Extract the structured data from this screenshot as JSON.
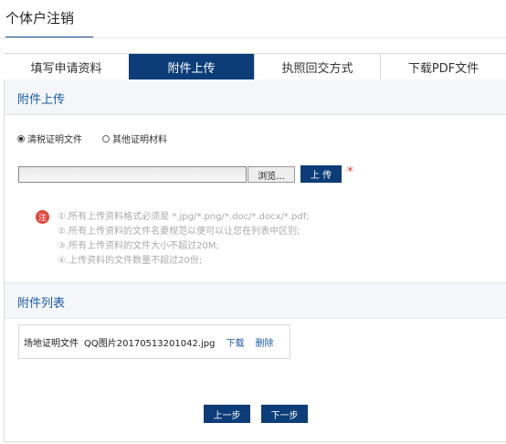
{
  "page": {
    "title": "个体户注销"
  },
  "tabs": [
    {
      "label": "填写申请资料"
    },
    {
      "label": "附件上传"
    },
    {
      "label": "执照回交方式"
    },
    {
      "label": "下载PDF文件"
    }
  ],
  "upload_section": {
    "title": "附件上传",
    "radio_options": [
      {
        "label": "清税证明文件",
        "selected": true
      },
      {
        "label": "其他证明材料",
        "selected": false
      }
    ],
    "browse_label": "浏览...",
    "upload_label": "上 传",
    "required_mark": "*",
    "note_icon_label": "注",
    "notes": [
      "①.所有上传资料格式必须是 *.jpg/*.png/*.doc/*.docx/*.pdf;",
      "②.所有上传资料的文件名要规范以便可以让您在列表中区别;",
      "③.所有上传资料的文件大小不超过20M;",
      "④.上传资料的文件数量不超过20份;"
    ]
  },
  "list_section": {
    "title": "附件列表",
    "files": [
      {
        "type": "场地证明文件",
        "name": "QQ图片20170513201042.jpg",
        "download": "下载",
        "delete": "删除"
      }
    ]
  },
  "buttons": {
    "prev": "上一步",
    "next": "下一步"
  },
  "colors": {
    "primary": "#0d3d78",
    "link": "#1a5aa5",
    "required": "#e03030",
    "note_icon": "#e2473c"
  }
}
